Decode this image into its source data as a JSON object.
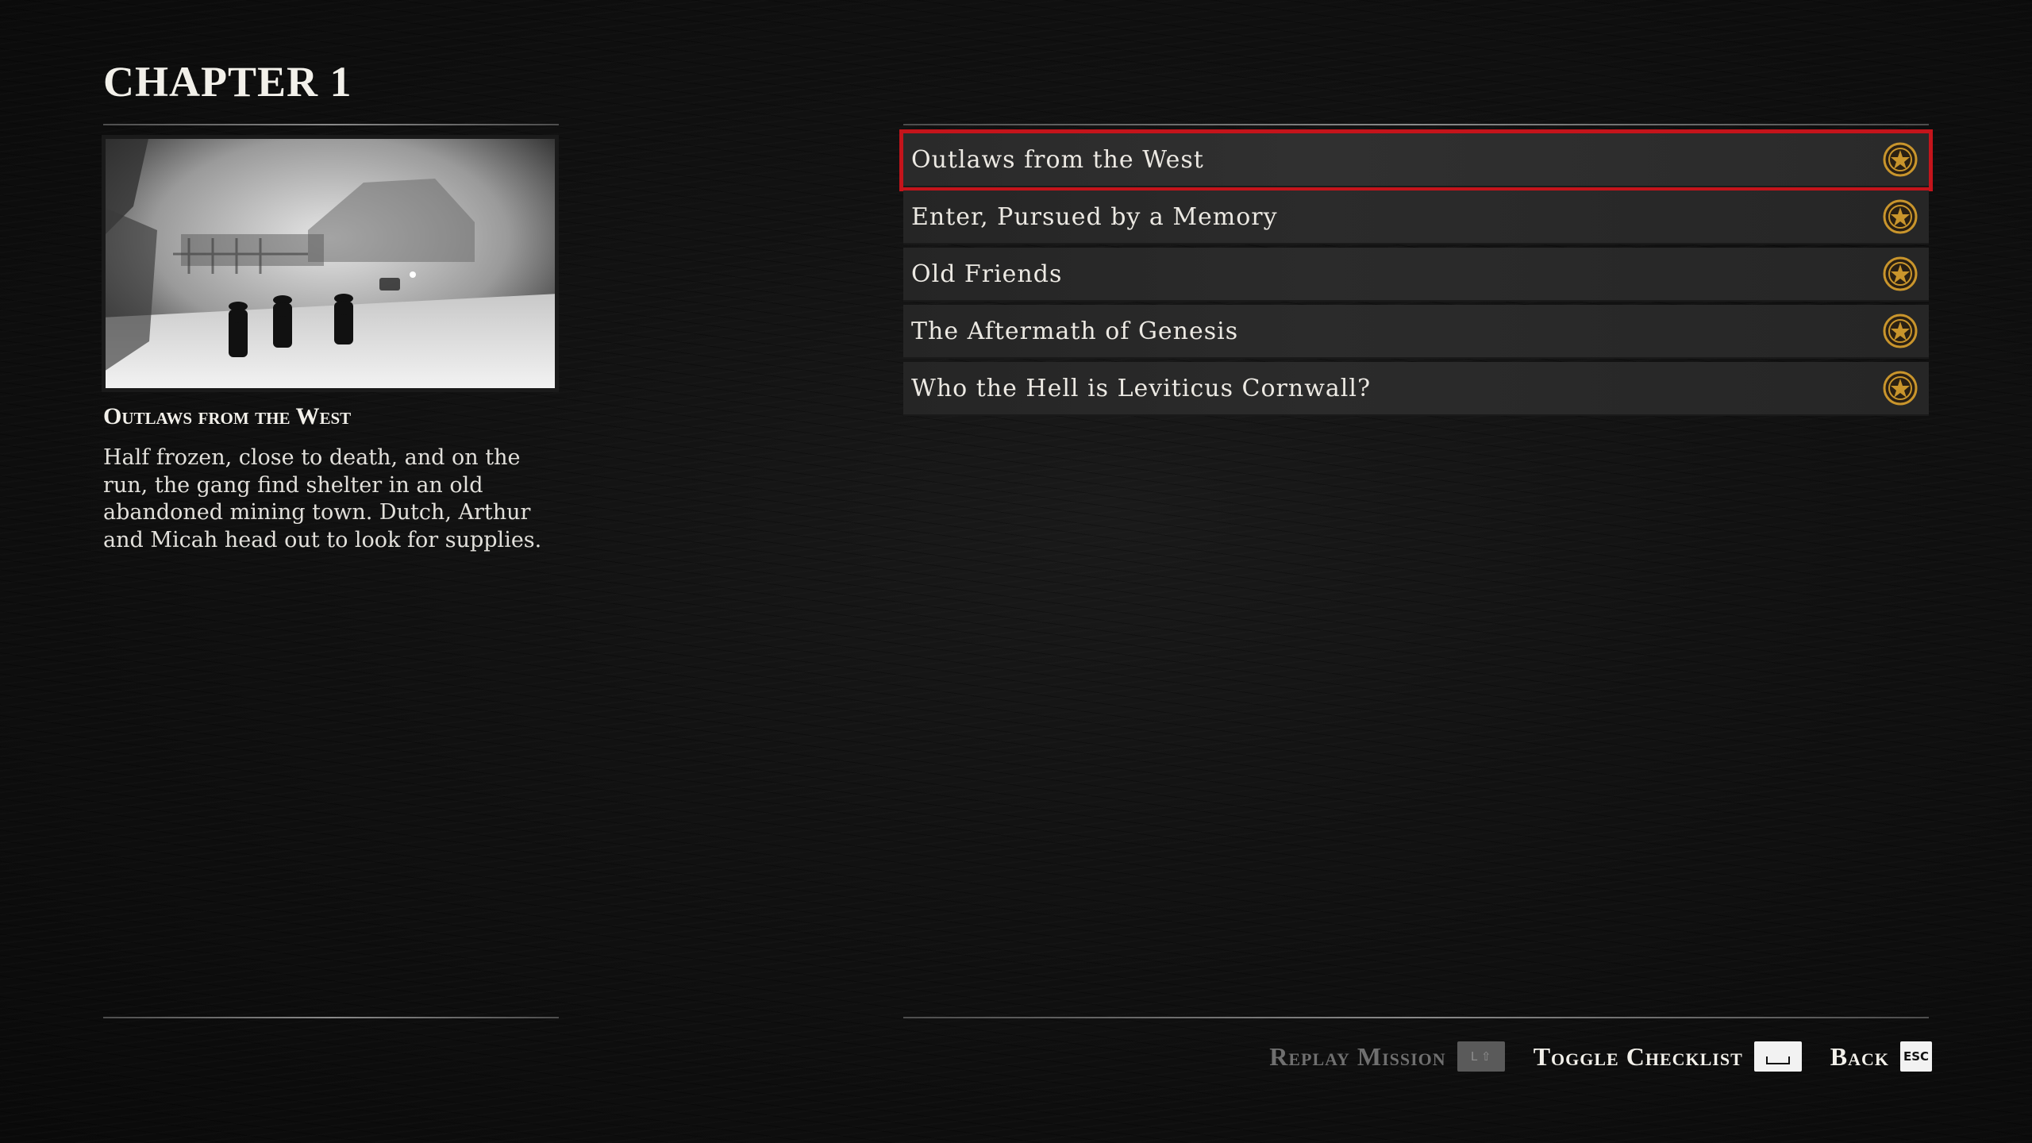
{
  "chapter": {
    "title": "CHAPTER 1"
  },
  "selected_mission": {
    "title": "Outlaws from the West",
    "description": "Half frozen, close to death, and on the run, the gang find shelter in an old abandoned mining town. Dutch, Arthur and Micah head out to look for supplies."
  },
  "missions": [
    {
      "label": "Outlaws from the West",
      "selected": true,
      "medal_icon": "gold-medal-icon"
    },
    {
      "label": "Enter, Pursued by a Memory",
      "selected": false,
      "medal_icon": "gold-medal-icon"
    },
    {
      "label": "Old Friends",
      "selected": false,
      "medal_icon": "gold-medal-icon"
    },
    {
      "label": "The Aftermath of Genesis",
      "selected": false,
      "medal_icon": "gold-medal-icon"
    },
    {
      "label": "Who the Hell is Leviticus Cornwall?",
      "selected": false,
      "medal_icon": "gold-medal-icon"
    }
  ],
  "footer": {
    "replay": {
      "label": "Replay Mission",
      "key": "L ⇧",
      "enabled": false
    },
    "toggle_checklist": {
      "label": "Toggle Checklist",
      "key": "space",
      "enabled": true
    },
    "back": {
      "label": "Back",
      "key": "ESC",
      "enabled": true
    }
  },
  "colors": {
    "selection_outline": "#c4141b",
    "medal_gold": "#c9952c",
    "background": "#0d0d0d"
  }
}
